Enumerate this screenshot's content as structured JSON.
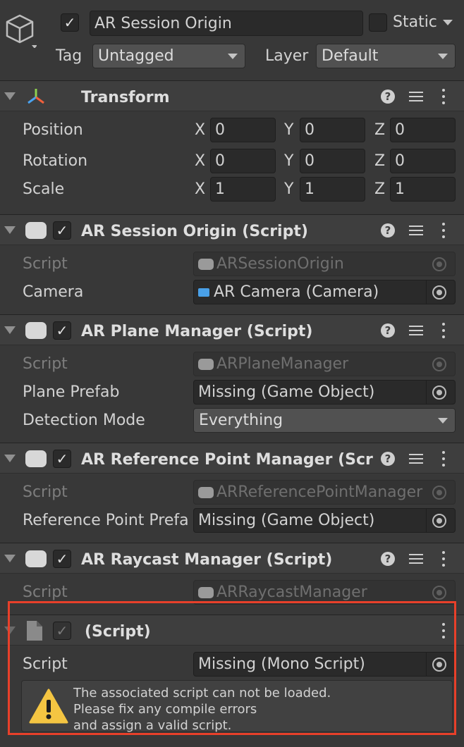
{
  "go": {
    "name": "AR Session Origin",
    "static_label": "Static",
    "tag_label": "Tag",
    "tag_value": "Untagged",
    "layer_label": "Layer",
    "layer_value": "Default"
  },
  "transform": {
    "title": "Transform",
    "rows": [
      {
        "label": "Position",
        "x": "0",
        "y": "0",
        "z": "0"
      },
      {
        "label": "Rotation",
        "x": "0",
        "y": "0",
        "z": "0"
      },
      {
        "label": "Scale",
        "x": "1",
        "y": "1",
        "z": "1"
      }
    ],
    "axis": {
      "x": "X",
      "y": "Y",
      "z": "Z"
    }
  },
  "session_origin": {
    "title": "AR Session Origin (Script)",
    "script_label": "Script",
    "script_value": "ARSessionOrigin",
    "camera_label": "Camera",
    "camera_value": "AR Camera (Camera)"
  },
  "plane_manager": {
    "title": "AR Plane Manager (Script)",
    "script_label": "Script",
    "script_value": "ARPlaneManager",
    "prefab_label": "Plane Prefab",
    "prefab_value": "Missing (Game Object)",
    "detection_label": "Detection Mode",
    "detection_value": "Everything"
  },
  "refpoint_manager": {
    "title": "AR Reference Point Manager (Scrip",
    "script_label": "Script",
    "script_value": "ARReferencePointManager",
    "prefab_label": "Reference Point Prefa",
    "prefab_value": "Missing (Game Object)"
  },
  "raycast_manager": {
    "title": "AR Raycast Manager (Script)",
    "script_label": "Script",
    "script_value": "ARRaycastManager"
  },
  "missing_script": {
    "title": "(Script)",
    "script_label": "Script",
    "script_value": "Missing (Mono Script)",
    "warning_lines": [
      "The associated script can not be loaded.",
      "Please fix any compile errors",
      "and assign a valid script."
    ]
  },
  "colors": {
    "highlight": "#e8402a",
    "warning": "#f4c542"
  }
}
